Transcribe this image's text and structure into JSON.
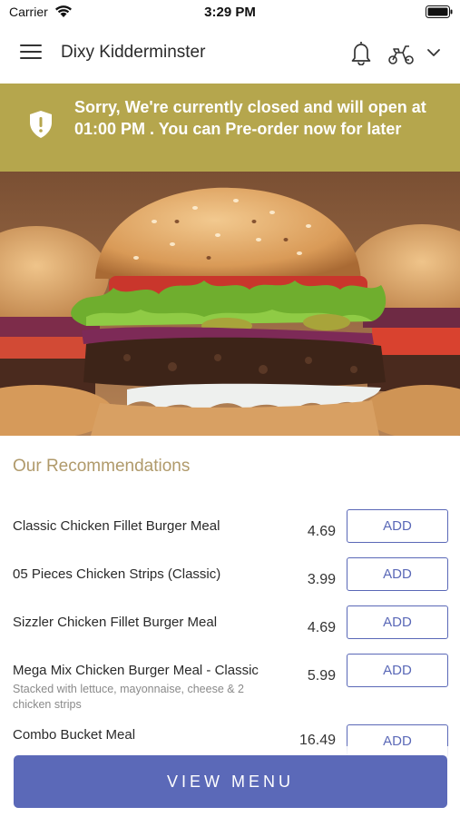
{
  "status_bar": {
    "carrier": "Carrier",
    "time": "3:29 PM"
  },
  "header": {
    "title": "Dixy Kidderminster",
    "icons": [
      "menu-icon",
      "bell-icon",
      "scooter-icon",
      "chevron-down-icon"
    ]
  },
  "banner": {
    "message": "Sorry, We're currently closed and will open at 01:00 PM . You can Pre-order now for later",
    "color": "#b5a64d",
    "icon": "shield-alert-icon"
  },
  "hero": {
    "image": "burger-photo"
  },
  "recommendations": {
    "title": "Our Recommendations",
    "items": [
      {
        "name": "Classic Chicken Fillet Burger Meal",
        "description": "",
        "price": "4.69",
        "button": "ADD"
      },
      {
        "name": "05 Pieces Chicken Strips (Classic)",
        "description": "",
        "price": "3.99",
        "button": "ADD"
      },
      {
        "name": "Sizzler Chicken Fillet Burger Meal",
        "description": "",
        "price": "4.69",
        "button": "ADD"
      },
      {
        "name": "Mega Mix Chicken Burger Meal - Classic",
        "description": "Stacked with lettuce, mayonnaise, cheese & 2 chicken strips",
        "price": "5.99",
        "button": "ADD"
      },
      {
        "name": "Combo Bucket Meal",
        "description": "",
        "price": "16.49",
        "button": "ADD"
      }
    ]
  },
  "footer": {
    "view_menu_label": "VIEW MENU",
    "accent": "#5b69b8"
  }
}
